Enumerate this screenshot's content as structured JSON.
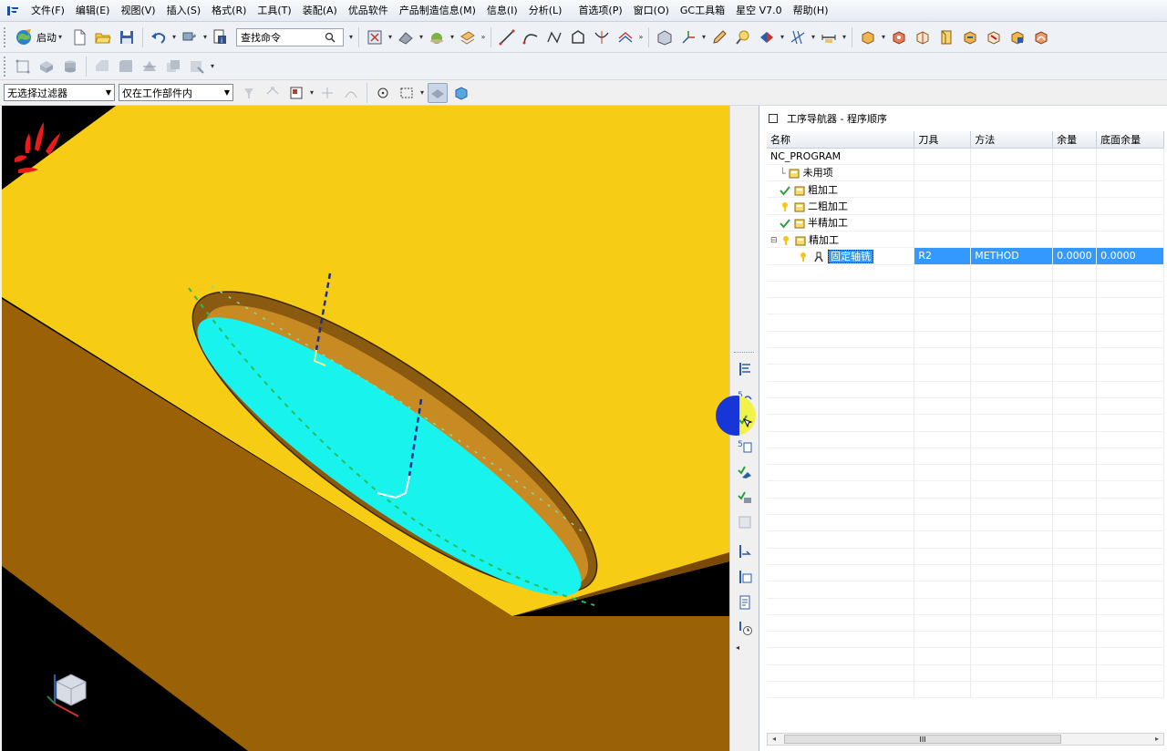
{
  "menubar": {
    "items": [
      "文件(F)",
      "编辑(E)",
      "视图(V)",
      "插入(S)",
      "格式(R)",
      "工具(T)",
      "装配(A)",
      "优品软件",
      "产品制造信息(M)",
      "信息(I)",
      "分析(L)",
      "首选项(P)",
      "窗口(O)",
      "GC工具箱",
      "星空 V7.0",
      "帮助(H)"
    ]
  },
  "toolbar": {
    "start_label": "启动",
    "search_value": "查找命令"
  },
  "filters": {
    "selection_filter": "无选择过滤器",
    "scope_filter": "仅在工作部件内"
  },
  "navigator": {
    "title": "工序导航器 - 程序顺序",
    "columns": [
      "名称",
      "刀具",
      "方法",
      "余量",
      "底面余量"
    ],
    "rows": [
      {
        "name": "NC_PROGRAM",
        "tool": "",
        "method": "",
        "stock": "",
        "floor": "",
        "status": "none"
      },
      {
        "name": "未用项",
        "tool": "",
        "method": "",
        "stock": "",
        "floor": "",
        "status": "none"
      },
      {
        "name": "粗加工",
        "tool": "",
        "method": "",
        "stock": "",
        "floor": "",
        "status": "check"
      },
      {
        "name": "二粗加工",
        "tool": "",
        "method": "",
        "stock": "",
        "floor": "",
        "status": "regen"
      },
      {
        "name": "半精加工",
        "tool": "",
        "method": "",
        "stock": "",
        "floor": "",
        "status": "check"
      },
      {
        "name": "精加工",
        "tool": "",
        "method": "",
        "stock": "",
        "floor": "",
        "status": "regen"
      },
      {
        "name": "固定轴铣",
        "tool": "R2",
        "method": "METHOD",
        "stock": "0.0000",
        "floor": "0.0000",
        "status": "regen"
      }
    ],
    "scroll_marker": "III"
  },
  "colors": {
    "part_top": "#f7cc14",
    "part_side": "#9b6106",
    "floor": "#19f3ee",
    "selection": "#3399ff"
  }
}
